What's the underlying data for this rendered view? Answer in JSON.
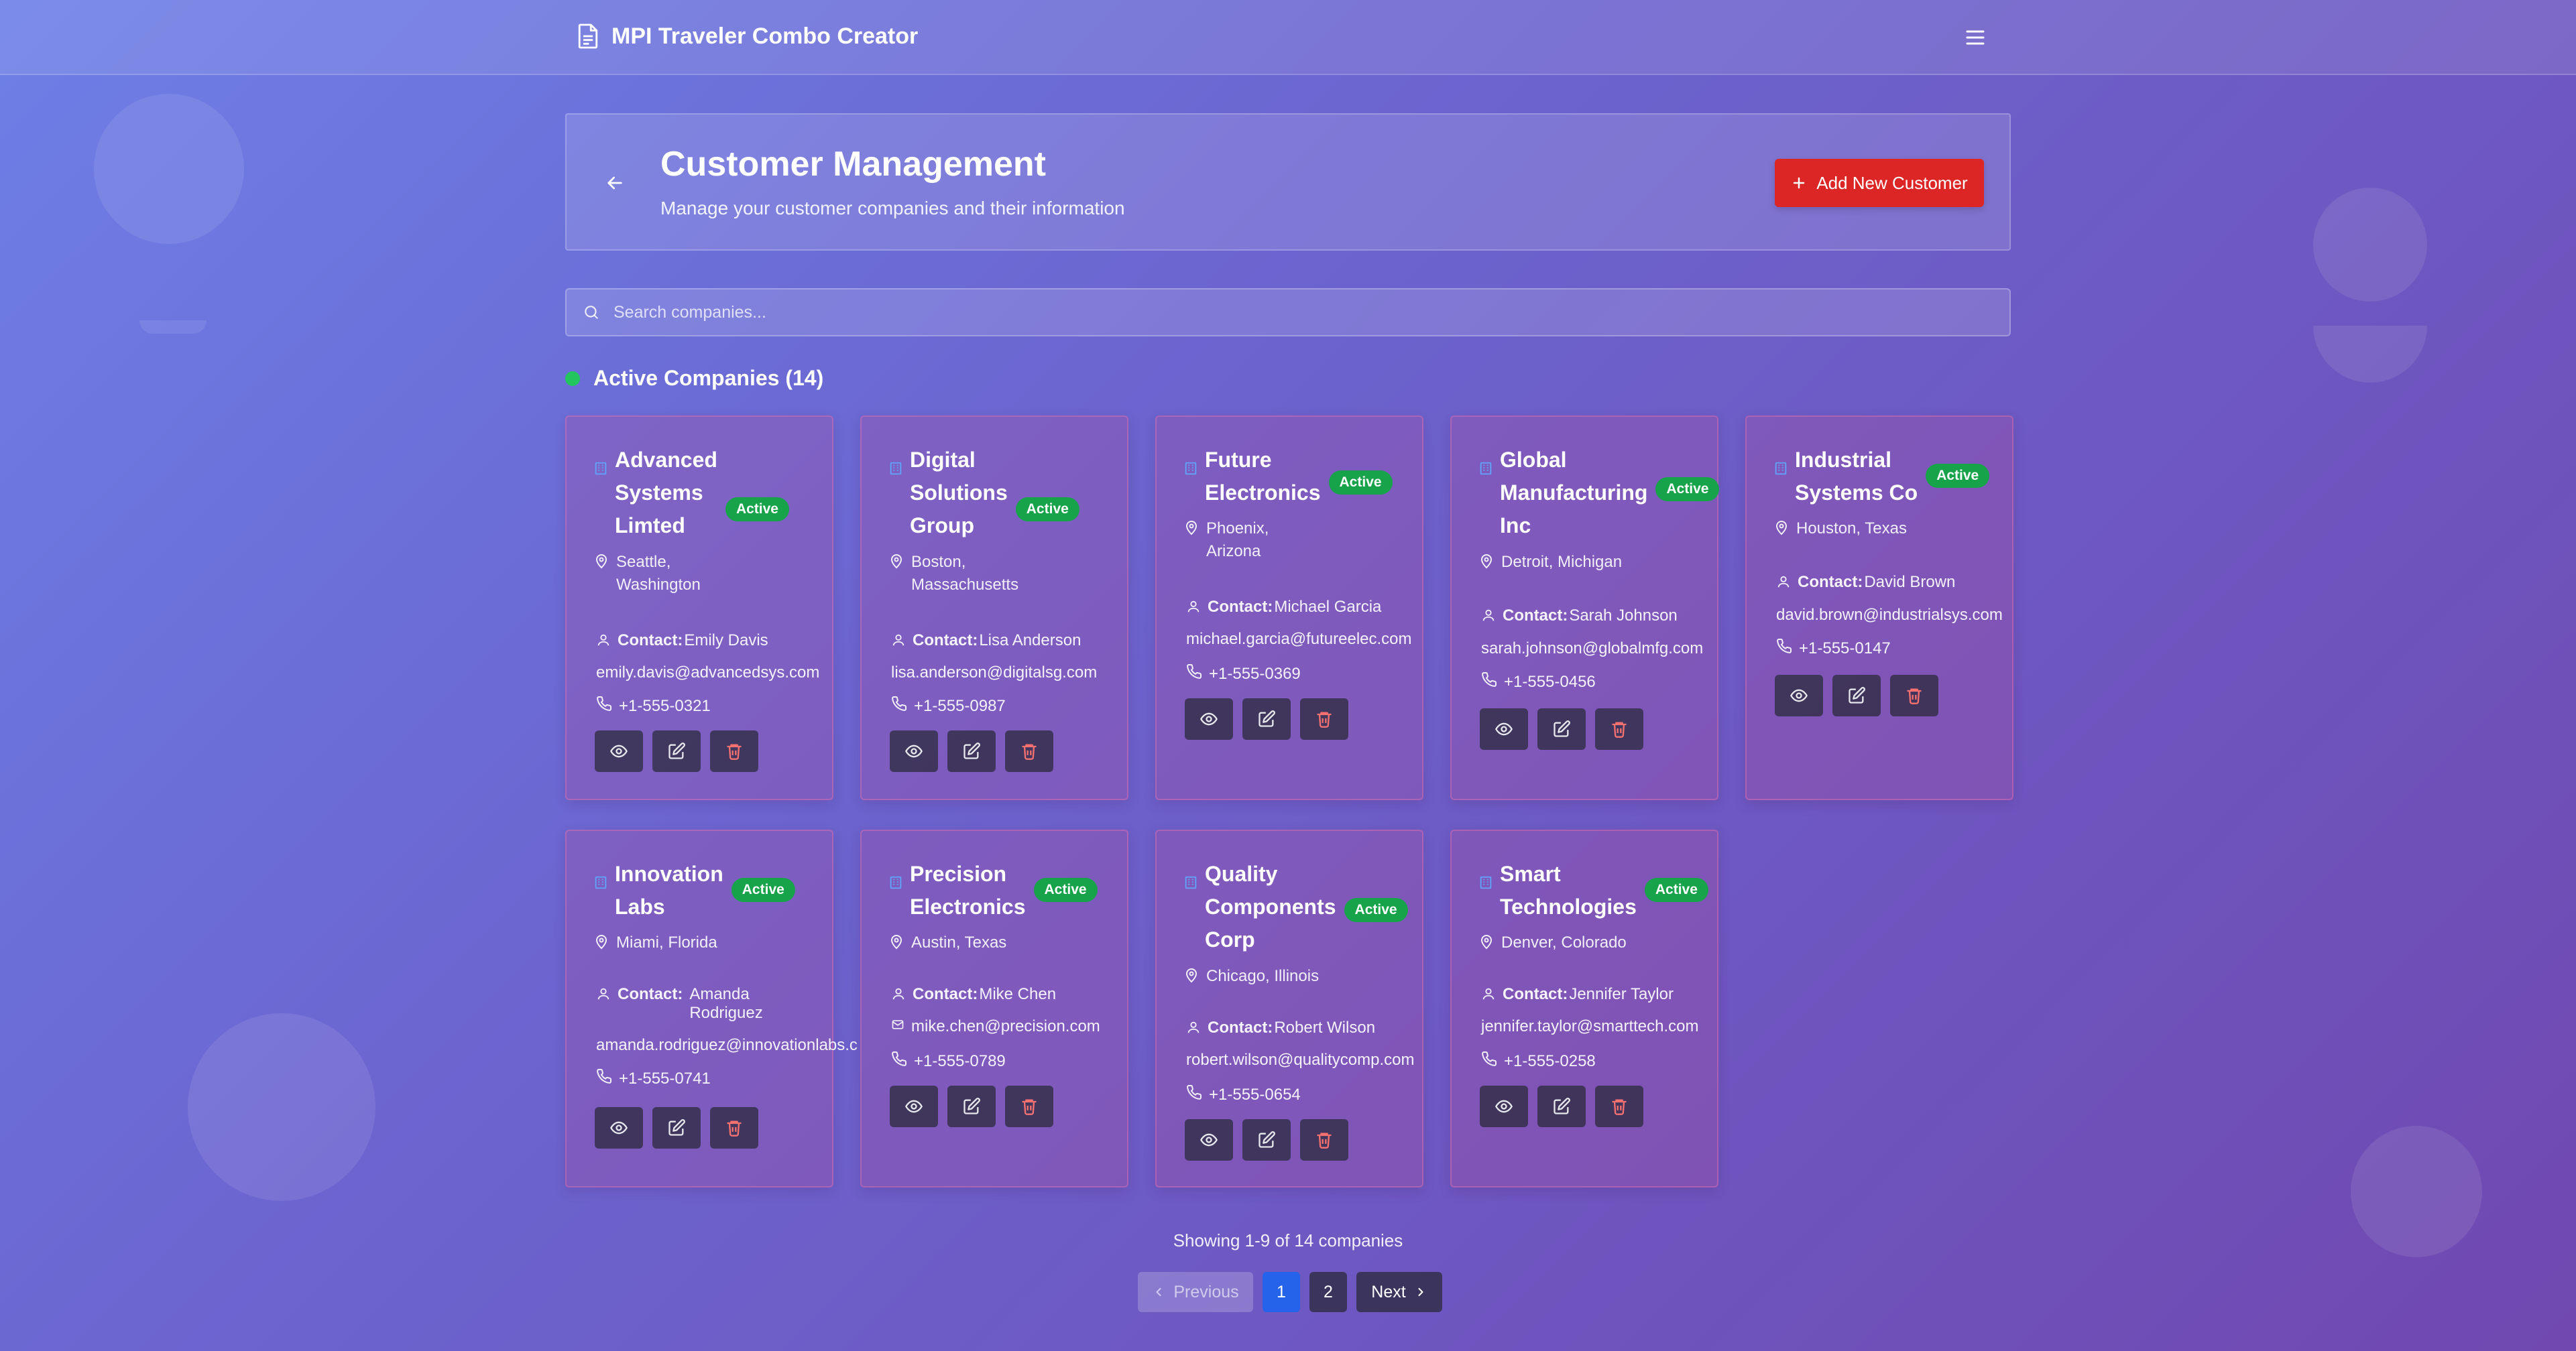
{
  "app": {
    "title": "MPI Traveler Combo Creator",
    "doc_icon": "document-icon",
    "menu_icon": "hamburger-menu-icon"
  },
  "header": {
    "title": "Customer Management",
    "subtitle": "Manage your customer companies and their information",
    "add_button": "Add New Customer"
  },
  "search": {
    "placeholder": "Search companies..."
  },
  "section": {
    "title": "Active Companies (14)"
  },
  "status_label": "Active",
  "contact_label": "Contact:",
  "companies": [
    {
      "name": "Advanced Systems Limted",
      "name_lines": [
        "Advanced",
        "Systems",
        "Limted"
      ],
      "location": "Seattle, Washington",
      "location_lines": [
        "Seattle,",
        "Washington"
      ],
      "contact": "Emily Davis",
      "email": "emily.davis@advancedsys.com",
      "phone": "+1-555-0321"
    },
    {
      "name": "Digital Solutions Group",
      "name_lines": [
        "Digital",
        "Solutions",
        "Group"
      ],
      "location": "Boston, Massachusetts",
      "location_lines": [
        "Boston,",
        "Massachusetts"
      ],
      "contact": "Lisa Anderson",
      "email": "lisa.anderson@digitalsg.com",
      "phone": "+1-555-0987"
    },
    {
      "name": "Future Electronics",
      "name_lines": [
        "Future",
        "Electronics"
      ],
      "location": "Phoenix, Arizona",
      "location_lines": [
        "Phoenix,",
        "Arizona"
      ],
      "contact": "Michael Garcia",
      "email": "michael.garcia@futureelec.com",
      "phone": "+1-555-0369"
    },
    {
      "name": "Global Manufacturing Inc",
      "name_lines": [
        "Global",
        "Manufacturing",
        "Inc"
      ],
      "location": "Detroit, Michigan",
      "location_lines": [
        "Detroit, Michigan"
      ],
      "contact": "Sarah Johnson",
      "email": "sarah.johnson@globalmfg.com",
      "phone": "+1-555-0456"
    },
    {
      "name": "Industrial Systems Co",
      "name_lines": [
        "Industrial",
        "Systems Co"
      ],
      "location": "Houston, Texas",
      "location_lines": [
        "Houston, Texas"
      ],
      "contact": "David Brown",
      "email": "david.brown@industrialsys.com",
      "phone": "+1-555-0147"
    },
    {
      "name": "Innovation Labs",
      "name_lines": [
        "Innovation",
        "Labs"
      ],
      "location": "Miami, Florida",
      "location_lines": [
        "Miami, Florida"
      ],
      "contact": "Amanda Rodriguez",
      "contact_lines": [
        "Amanda",
        "Rodriguez"
      ],
      "email": "amanda.rodriguez@innovationlabs.c",
      "phone": "+1-555-0741"
    },
    {
      "name": "Precision Electronics",
      "name_lines": [
        "Precision",
        "Electronics"
      ],
      "location": "Austin, Texas",
      "location_lines": [
        "Austin, Texas"
      ],
      "contact": "Mike Chen",
      "email": "mike.chen@precision.com",
      "phone": "+1-555-0789"
    },
    {
      "name": "Quality Components Corp",
      "name_lines": [
        "Quality",
        "Components",
        "Corp"
      ],
      "location": "Chicago, Illinois",
      "location_lines": [
        "Chicago, Illinois"
      ],
      "contact": "Robert Wilson",
      "email": "robert.wilson@qualitycomp.com",
      "phone": "+1-555-0654"
    },
    {
      "name": "Smart Technologies",
      "name_lines": [
        "Smart",
        "Technologies"
      ],
      "location": "Denver, Colorado",
      "location_lines": [
        "Denver, Colorado"
      ],
      "contact": "Jennifer Taylor",
      "email": "jennifer.taylor@smarttech.com",
      "phone": "+1-555-0258"
    }
  ],
  "action_icons": [
    "eye-icon",
    "edit-icon",
    "trash-icon"
  ],
  "pagination": {
    "showing": "Showing 1-9 of 14 companies",
    "previous": "Previous",
    "pages": [
      "1",
      "2"
    ],
    "current_page": "1",
    "next": "Next"
  },
  "colors": {
    "accent_red": "#dc2626",
    "status_green": "#16a34a",
    "page_blue": "#2563eb",
    "bg_start": "#6d7fe6",
    "bg_end": "#7048b0"
  }
}
